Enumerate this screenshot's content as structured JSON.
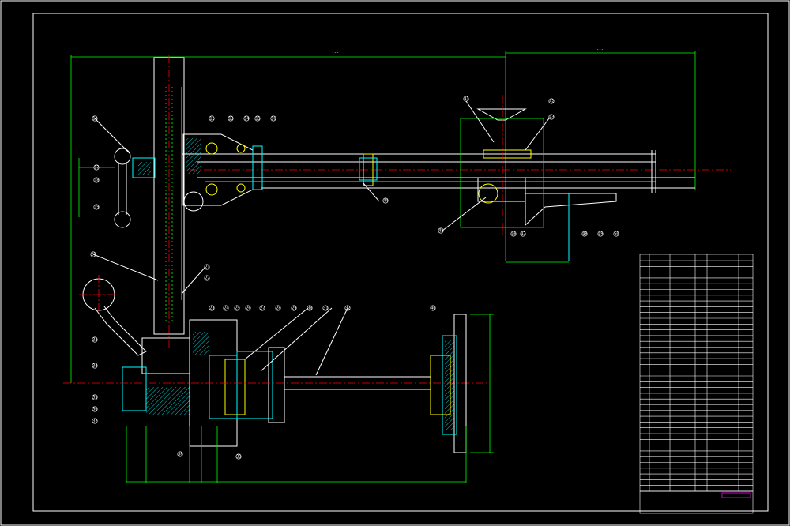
{
  "drawing": {
    "part_labels": [
      "11",
      "12",
      "13",
      "14",
      "15",
      "16",
      "17",
      "18",
      "19",
      "20",
      "21",
      "22",
      "23",
      "24",
      "25",
      "26",
      "27",
      "28",
      "29",
      "30",
      "31",
      "32",
      "33",
      "34",
      "35",
      "36",
      "37",
      "38",
      "39",
      "40",
      "41",
      "42",
      "43",
      "44",
      "45",
      "46",
      "47",
      "48",
      "49",
      "50"
    ],
    "colors": {
      "background": "#000000",
      "outline": "#ffffff",
      "dimension": "#00ff00",
      "section": "#00ffff",
      "center_line": "#ff0000",
      "detail": "#ffff00"
    }
  }
}
